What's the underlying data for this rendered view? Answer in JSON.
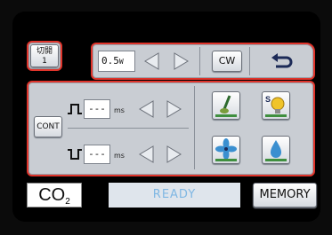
{
  "mode_button": {
    "line1": "切開",
    "line2": "1"
  },
  "power": {
    "value": "0.5",
    "unit": "W"
  },
  "direction_label": "CW",
  "return_icon": "return-arrow-icon",
  "cont_label": "CONT",
  "on_time": {
    "value": "---",
    "unit": "ms"
  },
  "off_time": {
    "value": "---",
    "unit": "ms"
  },
  "function_icons": [
    "brush-icon",
    "s-bulb-icon",
    "fan-icon",
    "water-drop-icon"
  ],
  "bottom": {
    "gas_label": "CO",
    "gas_sub": "2",
    "status": "READY",
    "memory_label": "MEMORY"
  },
  "colors": {
    "accent": "#e0342b",
    "status_text": "#7fb7e3",
    "panel": "#c9cdd3"
  }
}
